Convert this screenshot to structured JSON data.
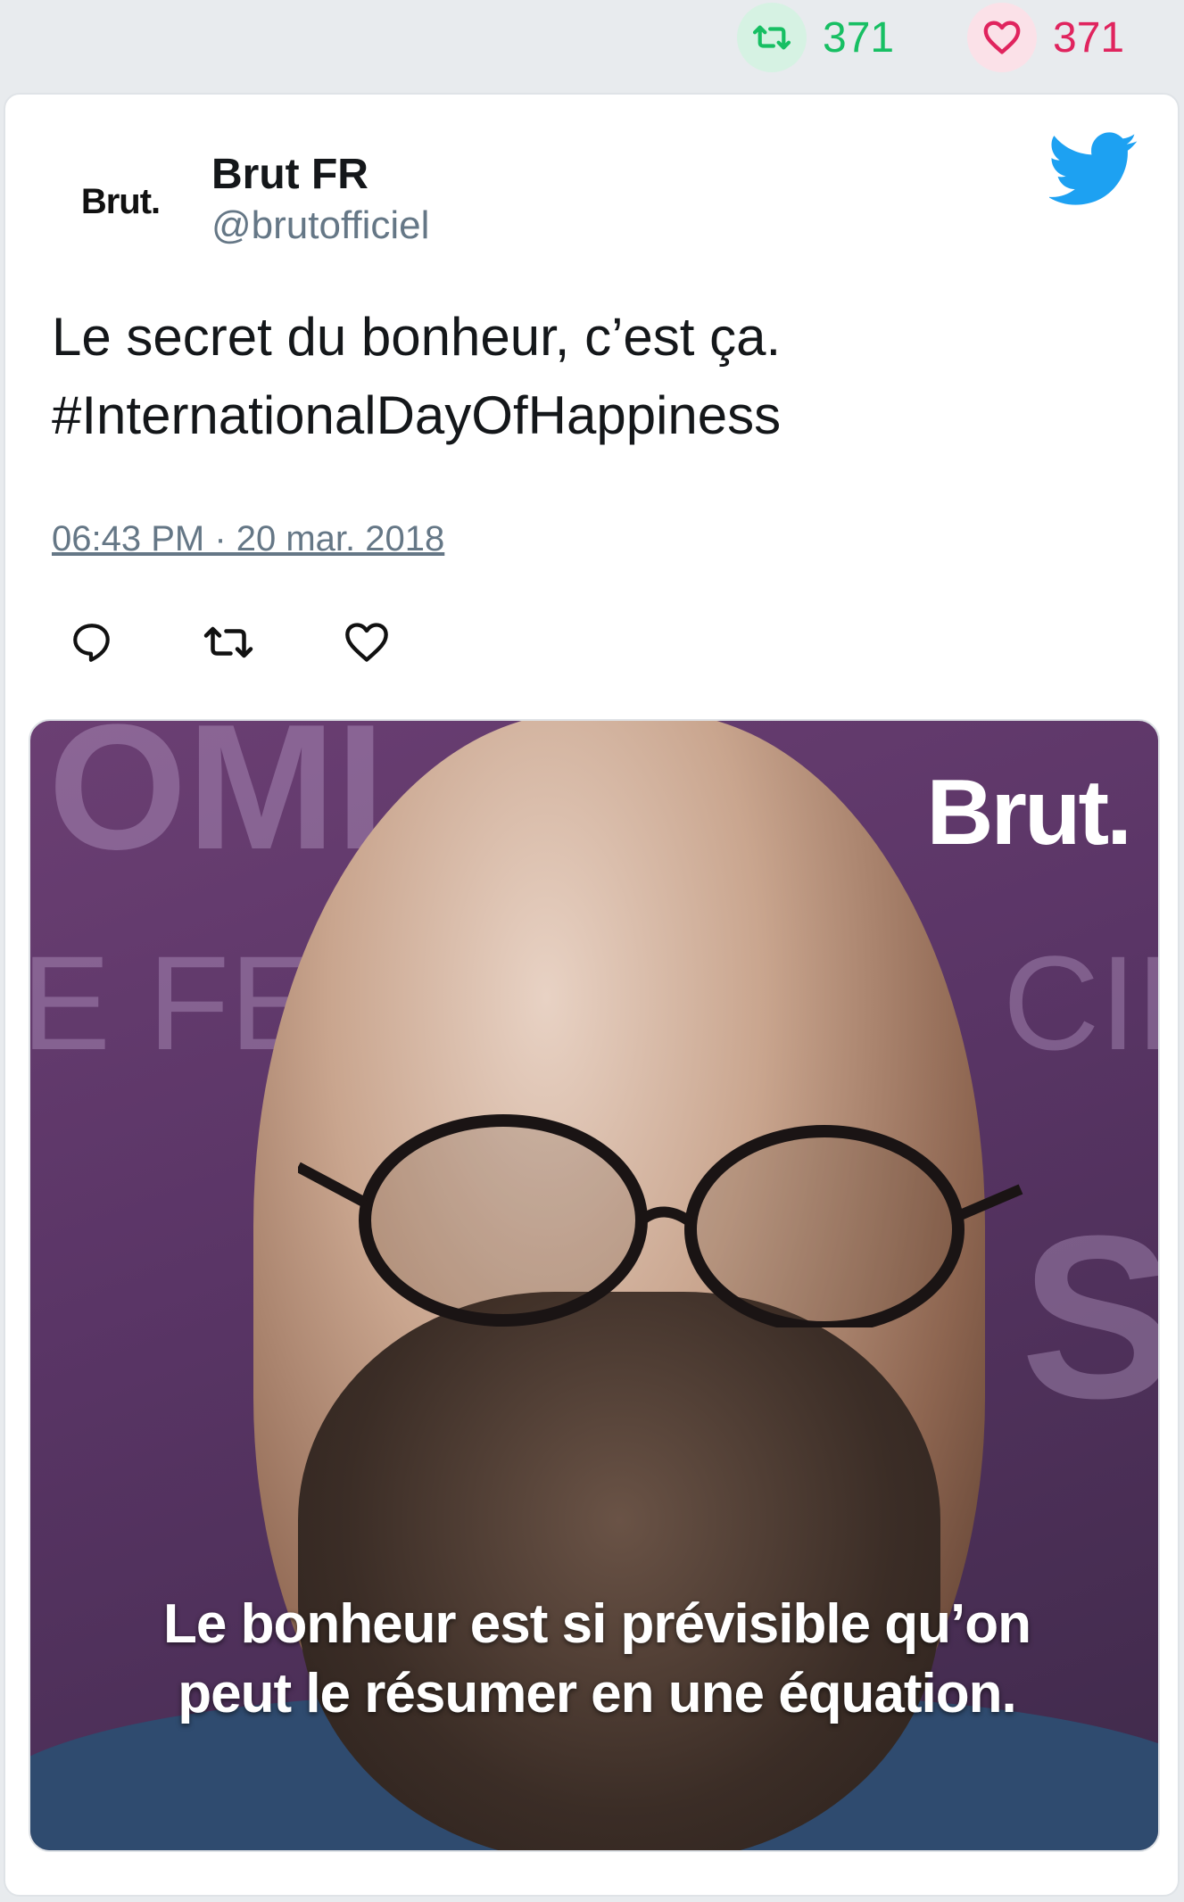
{
  "metrics": {
    "retweet_count": "371",
    "like_count": "371",
    "retweet_icon": "retweet-icon",
    "like_icon": "heart-icon",
    "retweet_color": "#17bf63",
    "like_color": "#e0245e"
  },
  "tweet": {
    "avatar_text": "Brut.",
    "author_name": "Brut FR",
    "author_handle": "@brutofficiel",
    "platform_icon": "twitter-bird-icon",
    "platform_color": "#1da1f2",
    "text_lines": [
      "Le secret du bonheur, c’est ça.",
      "#InternationalDayOfHappiness"
    ],
    "timestamp": "06:43 PM · 20 mar. 2018",
    "actions": [
      {
        "name": "reply",
        "icon": "reply-icon"
      },
      {
        "name": "retweet",
        "icon": "retweet-icon"
      },
      {
        "name": "like",
        "icon": "heart-icon"
      }
    ]
  },
  "media": {
    "brand_mark": "Brut.",
    "background_letters": [
      "OMI",
      "E FE",
      "CIE",
      "S"
    ],
    "caption_lines": [
      "Le bonheur est si prévisible qu’on",
      "peut le résumer en une équation."
    ]
  }
}
